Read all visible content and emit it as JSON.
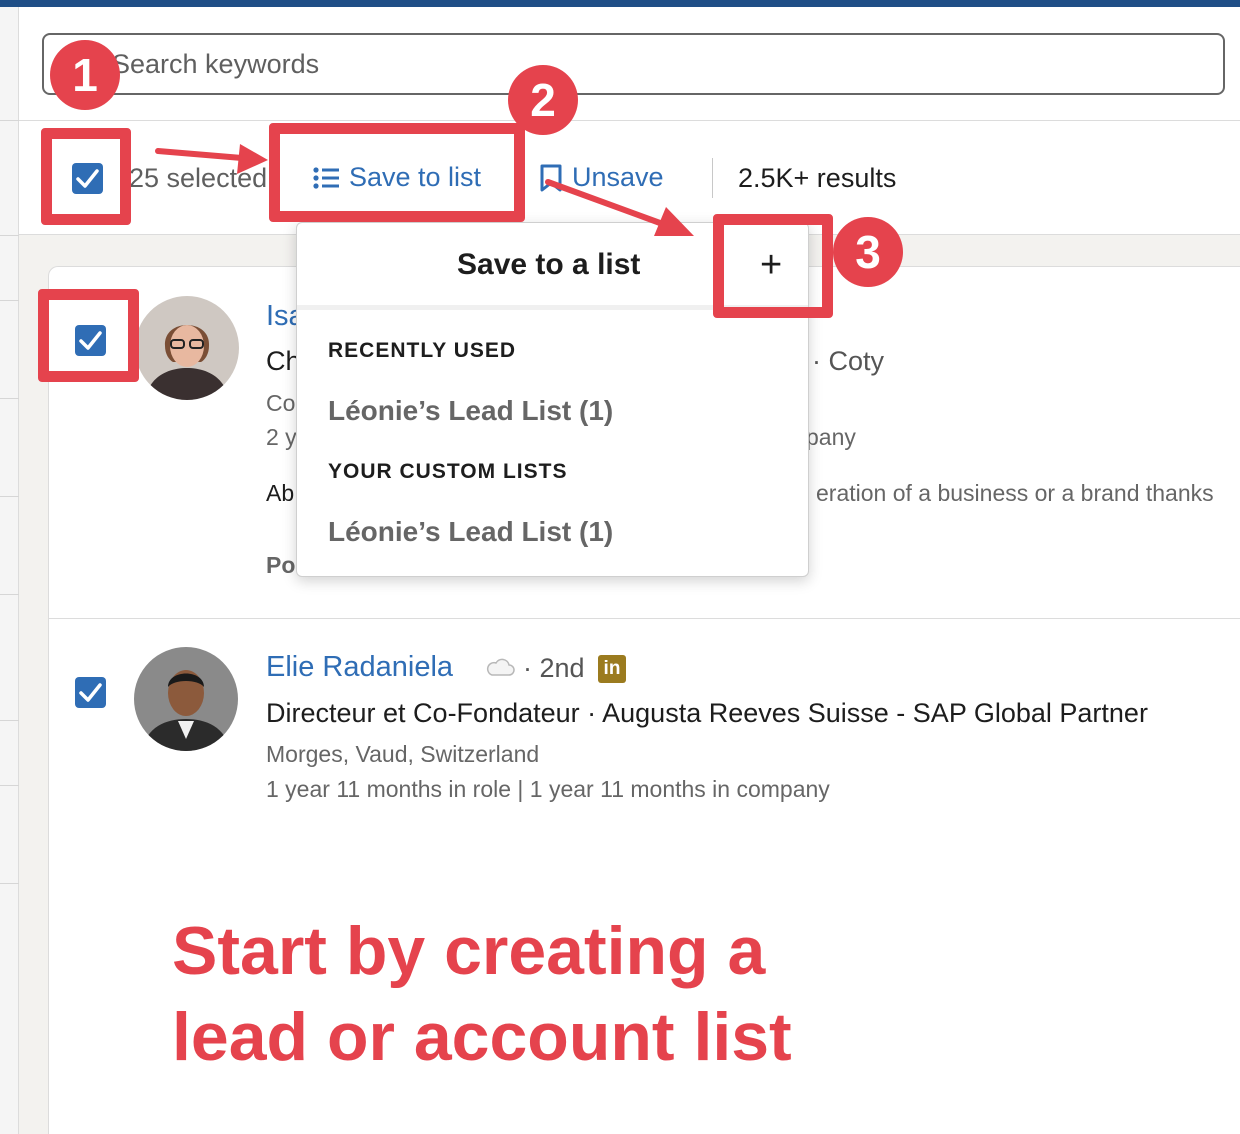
{
  "search": {
    "placeholder": "Search keywords"
  },
  "toolbar": {
    "selected_label": "25 selected",
    "save_to_list_label": "Save to list",
    "unsave_label": "Unsave",
    "results_label": "2.5K+ results"
  },
  "leads": [
    {
      "name_visible": "Isa",
      "role_start": "Ch",
      "role_end": "· Coty",
      "location_start": "Co",
      "tenure_start": "2 y",
      "tenure_end": "pany",
      "about_start": "Ab",
      "about_end": "eration of a business or a brand thanks",
      "posts_start": "Po",
      "checked": true
    },
    {
      "name": "Elie Radaniela",
      "degree": "· 2nd",
      "linkedin_badge": "in",
      "role": "Directeur et Co-Fondateur · Augusta Reeves Suisse - SAP Global Partner",
      "location": "Morges, Vaud, Switzerland",
      "tenure": "1 year 11 months in role | 1 year 11 months in company",
      "checked": true
    }
  ],
  "dropdown": {
    "title": "Save to a list",
    "add_symbol": "+",
    "sections": [
      {
        "heading": "RECENTLY USED",
        "items": [
          "Léonie’s Lead List (1)"
        ]
      },
      {
        "heading": "YOUR CUSTOM LISTS",
        "items": [
          "Léonie’s Lead List (1)"
        ]
      }
    ]
  },
  "annotations": {
    "steps": [
      "1",
      "2",
      "3"
    ],
    "caption_line1": "Start by creating a",
    "caption_line2": "lead or account list",
    "color": "#e5434d"
  },
  "colors": {
    "link_blue": "#2f6db5",
    "top_bar": "#1f4e86",
    "annotation_red": "#e5434d"
  }
}
